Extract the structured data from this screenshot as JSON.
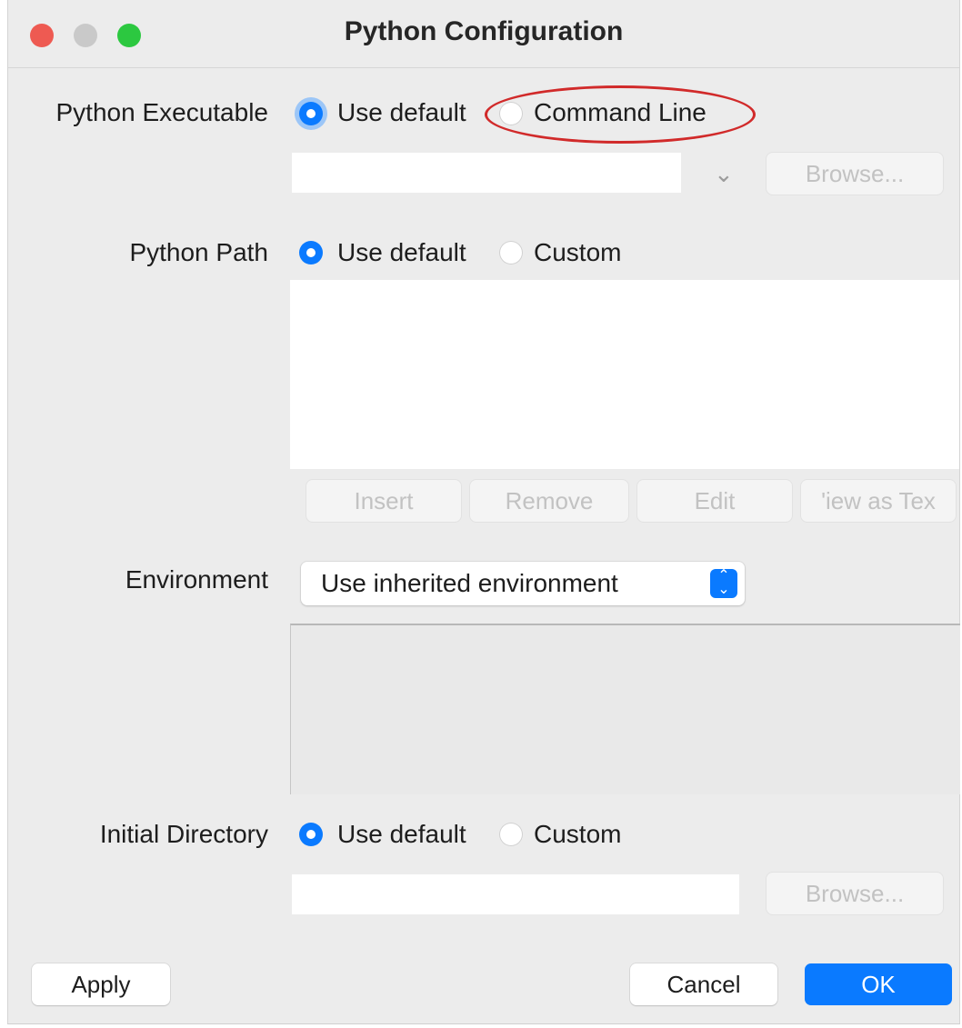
{
  "window": {
    "title": "Python Configuration",
    "controls": [
      "close-button",
      "minimize-button",
      "zoom-button"
    ],
    "accent_color": "#0a7aff"
  },
  "python_executable": {
    "label": "Python Executable",
    "option_default": "Use default",
    "option_other": "Command Line",
    "selected": "Use default",
    "path_value": "",
    "browse_label": "Browse..."
  },
  "python_path": {
    "label": "Python Path",
    "option_default": "Use default",
    "option_other": "Custom",
    "selected": "Use default",
    "buttons": {
      "insert": "Insert",
      "remove": "Remove",
      "edit": "Edit",
      "view_as_text": "'iew as Tex"
    }
  },
  "environment": {
    "label": "Environment",
    "selected_option": "Use inherited environment"
  },
  "initial_directory": {
    "label": "Initial Directory",
    "option_default": "Use default",
    "option_other": "Custom",
    "selected": "Use default",
    "path_value": "",
    "browse_label": "Browse..."
  },
  "footer": {
    "apply": "Apply",
    "cancel": "Cancel",
    "ok": "OK"
  }
}
